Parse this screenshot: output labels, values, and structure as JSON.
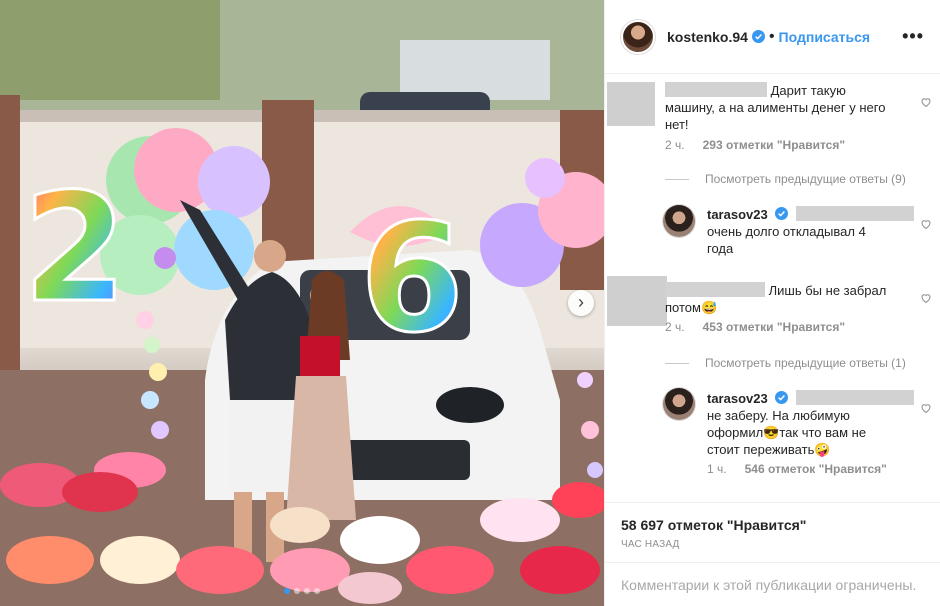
{
  "header": {
    "username": "kostenko.94",
    "follow_label": "Подписаться",
    "more_label": "•••"
  },
  "comments": [
    {
      "text_line1": "Дарит такую",
      "text_line2": "машину, а на алименты денег у него",
      "text_line3": "нет!",
      "time": "2 ч.",
      "likes": "293 отметки \"Нравится\""
    },
    {
      "view_prev": "Посмотреть предыдущие ответы (9)"
    },
    {
      "username": "tarasov23",
      "text_line1": "очень долго откладывал 4",
      "text_line2": "года"
    },
    {
      "text_line1": "Лишь бы не забрал",
      "text_line2": "потом😅",
      "time": "2 ч.",
      "likes": "453 отметки \"Нравится\""
    },
    {
      "view_prev": "Посмотреть предыдущие ответы (1)"
    },
    {
      "username": "tarasov23",
      "text_line1": "не заберу. На любимую",
      "text_line2": "оформил😎так что вам не",
      "text_line3": "стоит переживать🤪",
      "time": "1 ч.",
      "likes": "546 отметок \"Нравится\""
    }
  ],
  "footer": {
    "likes": "58 697 отметок \"Нравится\"",
    "time": "ЧАС НАЗАД",
    "restricted": "Комментарии к этой публикации ограничены."
  },
  "photo": {
    "balloon_left_number": "2",
    "balloon_right_number": "6",
    "carousel_dots": 4,
    "active_dot": 0
  },
  "colors": {
    "link": "#3897f0",
    "muted": "#8e8e8e",
    "text": "#262626"
  }
}
